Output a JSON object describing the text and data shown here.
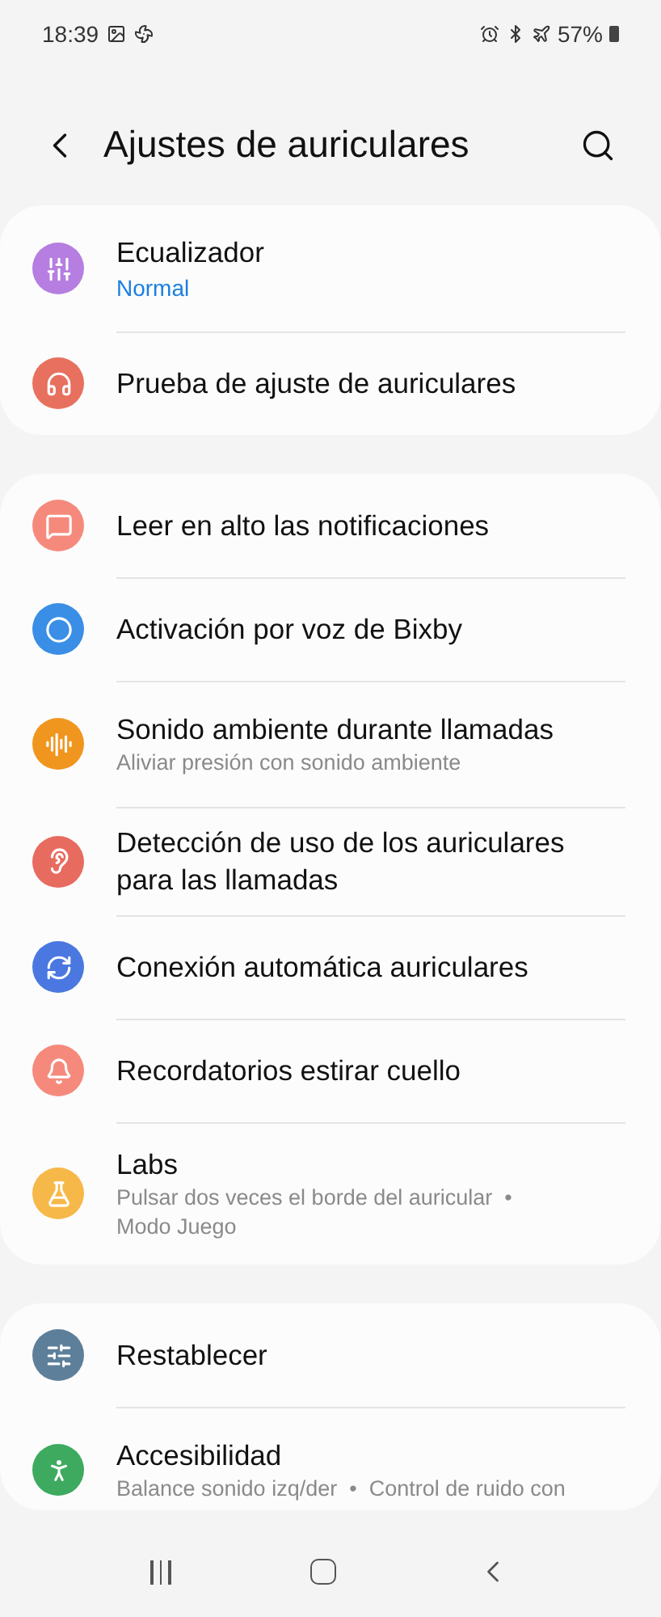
{
  "status_bar": {
    "time": "18:39",
    "battery": "57%"
  },
  "header": {
    "title": "Ajustes de auriculares"
  },
  "groups": [
    {
      "items": [
        {
          "title": "Ecualizador",
          "value": "Normal",
          "color": "#b57ee0"
        },
        {
          "title": "Prueba de ajuste de auriculares",
          "color": "#e8705f"
        }
      ]
    },
    {
      "items": [
        {
          "title": "Leer en alto las notificaciones",
          "color": "#f58a7c"
        },
        {
          "title": "Activación por voz de Bixby",
          "color": "#3a8ee6"
        },
        {
          "title": "Sonido ambiente durante llamadas",
          "subtitle": "Aliviar presión con sonido ambiente",
          "color": "#f0961f"
        },
        {
          "title": "Detección de uso de los auriculares para las llamadas",
          "color": "#e86b5f"
        },
        {
          "title": "Conexión automática auriculares",
          "color": "#4a78e0"
        },
        {
          "title": "Recordatorios estirar cuello",
          "color": "#f58a7c"
        },
        {
          "title": "Labs",
          "subtitle": "Pulsar dos veces el borde del auricular  •  Modo Juego",
          "color": "#f7b84a"
        }
      ]
    },
    {
      "items": [
        {
          "title": "Restablecer",
          "color": "#5d7f9a"
        },
        {
          "title": "Accesibilidad",
          "subtitle": "Balance sonido izq/der  •  Control de ruido con",
          "color": "#3daa5f"
        }
      ]
    }
  ]
}
